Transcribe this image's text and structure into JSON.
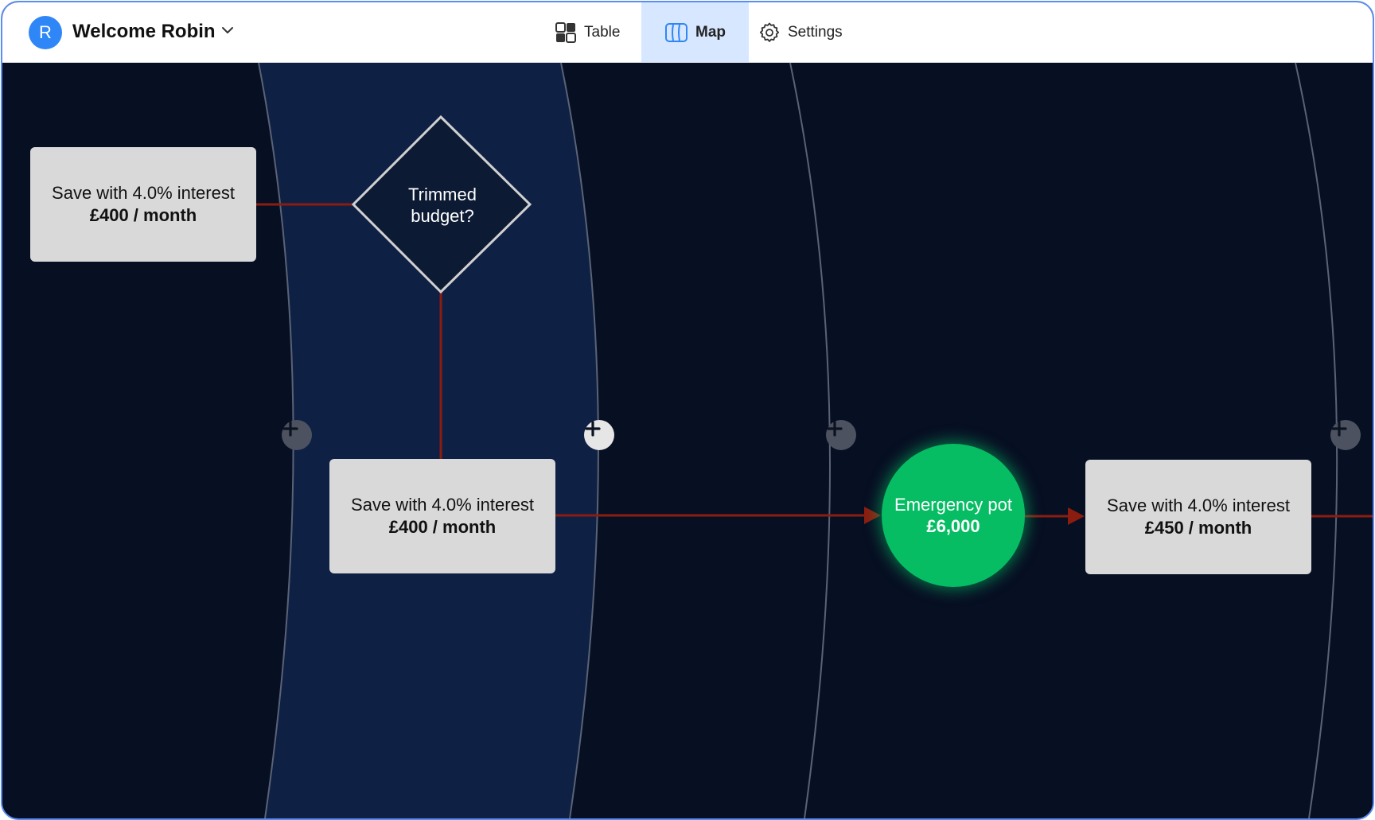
{
  "header": {
    "avatar_initial": "R",
    "welcome": "Welcome Robin",
    "tabs": [
      {
        "label": "Table",
        "icon": "table-grid-icon"
      },
      {
        "label": "Map",
        "icon": "map-icon",
        "active": true
      },
      {
        "label": "Settings",
        "icon": "gear-icon"
      }
    ]
  },
  "flow": {
    "nodes": [
      {
        "title": "Save with 4.0% interest",
        "amount": "£400 / month"
      },
      {
        "title": "Save with 4.0% interest",
        "amount": "£400 / month"
      },
      {
        "title": "Save with 4.0% interest",
        "amount": "£450 / month"
      }
    ],
    "decision": {
      "line1": "Trimmed",
      "line2": "budget?"
    },
    "goal": {
      "title": "Emergency pot",
      "amount": "£6,000"
    }
  },
  "colors": {
    "background": "#070f23",
    "highlight_lane": "#0f2045",
    "connector": "#8b1d10",
    "goal": "#06bd63",
    "accent": "#2f86f6",
    "active_tab": "#d7e7ff"
  }
}
